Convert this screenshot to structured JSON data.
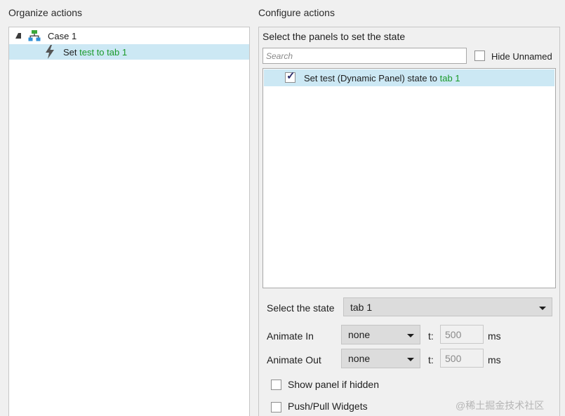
{
  "left": {
    "title": "Organize actions",
    "case_label": "Case 1",
    "action": {
      "prefix": "Set ",
      "target": "test to tab 1"
    }
  },
  "right": {
    "title": "Configure actions",
    "heading": "Select the panels to set the state",
    "search_placeholder": "Search",
    "hide_unnamed_label": "Hide Unnamed",
    "panel_row": {
      "checked": true,
      "prefix": "Set test (Dynamic Panel) state to ",
      "state": "tab 1"
    },
    "select_state_label": "Select the state",
    "state_value": "tab 1",
    "animate_in_label": "Animate In",
    "animate_in_value": "none",
    "animate_out_label": "Animate Out",
    "animate_out_value": "none",
    "t_label": "t:",
    "t_in_value": "500",
    "t_out_value": "500",
    "ms_label": "ms",
    "show_panel_label": "Show panel if hidden",
    "push_pull_label": "Push/Pull Widgets"
  },
  "watermark": "@稀土掘金技术社区",
  "colors": {
    "selection": "#cce8f4",
    "accent_green": "#1a9a2a"
  },
  "icons": {
    "case": "case-flow-icon",
    "action": "lightning-icon",
    "expander": "expand-triangle-icon"
  }
}
